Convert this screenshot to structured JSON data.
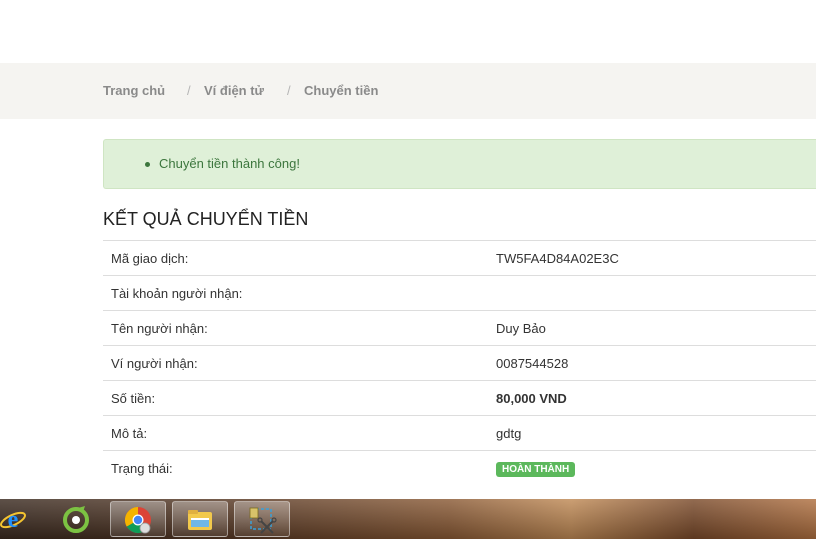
{
  "breadcrumb": {
    "items": [
      "Trang chủ",
      "Ví điện tử",
      "Chuyển tiền"
    ],
    "separator": "/"
  },
  "alert": {
    "message": "Chuyển tiền thành công!"
  },
  "result": {
    "title": "KẾT QUẢ CHUYỂN TIỀN",
    "rows": [
      {
        "label": "Mã giao dịch:",
        "value": "TW5FA4D84A02E3C"
      },
      {
        "label": "Tài khoản người nhận:",
        "value": ""
      },
      {
        "label": "Tên người nhận:",
        "value": "Duy Bảo"
      },
      {
        "label": "Ví người nhận:",
        "value": "0087544528"
      },
      {
        "label": "Số tiền:",
        "value": "80,000 VND"
      },
      {
        "label": "Mô tả:",
        "value": "gdtg"
      },
      {
        "label": "Trạng thái:",
        "value": "HOÀN THÀNH"
      }
    ]
  },
  "taskbar": {
    "apps": [
      "internet-explorer-icon",
      "coccoc-browser-icon",
      "chrome-icon",
      "file-explorer-icon",
      "snipping-tool-icon"
    ]
  },
  "colors": {
    "alert_bg": "#dff0d8",
    "alert_text": "#3c763d",
    "badge_bg": "#5cb85c",
    "breadcrumb_bg": "#f5f4f1"
  }
}
